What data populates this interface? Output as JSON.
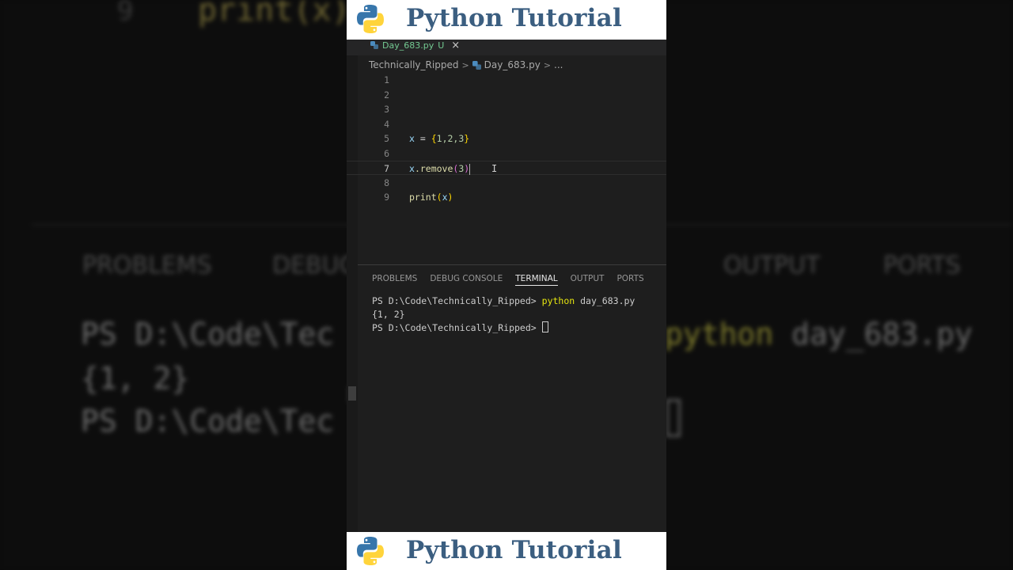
{
  "background": {
    "top_line_number": "9",
    "top_code": "print(x)",
    "panel_tabs": [
      "PROBLEMS",
      "DEBUG",
      "OUTPUT",
      "PORTS"
    ],
    "terminal_line1": "PS D:\\Code\\Tec",
    "terminal_line2": "{1, 2}",
    "terminal_line3": "PS D:\\Code\\Tec",
    "terminal_right_kw": "python",
    "terminal_right_rest": " day_683.py"
  },
  "banner": {
    "title": "Python Tutorial",
    "logo_icon": "python-logo-icon",
    "colors": {
      "title": "#3b5e80",
      "logo_blue": "#3776ab",
      "logo_yellow": "#ffd43b"
    }
  },
  "editor_tab": {
    "label": "Day_683.py",
    "status": "U",
    "close": "×"
  },
  "breadcrumb": {
    "folder": "Technically_Ripped",
    "file": "Day_683.py",
    "more": "..."
  },
  "editor": {
    "line_numbers": [
      "1",
      "2",
      "3",
      "4",
      "5",
      "6",
      "7",
      "8",
      "9"
    ],
    "line5": {
      "var": "x",
      "op": " = ",
      "open": "{",
      "nums": "1,2,3",
      "close": "}"
    },
    "line7": {
      "var": "x",
      "dot": ".remove",
      "open": "(",
      "arg": "3",
      "close": ")"
    },
    "line9": {
      "fn": "print",
      "open": "(",
      "arg": "x",
      "close": ")"
    },
    "current_line": 7
  },
  "panel": {
    "tabs": [
      "PROBLEMS",
      "DEBUG CONSOLE",
      "TERMINAL",
      "OUTPUT",
      "PORTS"
    ],
    "active_tab": "TERMINAL"
  },
  "terminal": {
    "prompt1": "PS D:\\Code\\Technically_Ripped> ",
    "cmd_kw": "python",
    "cmd_rest": " day_683.py",
    "output": "{1, 2}",
    "prompt2": "PS D:\\Code\\Technically_Ripped> "
  }
}
